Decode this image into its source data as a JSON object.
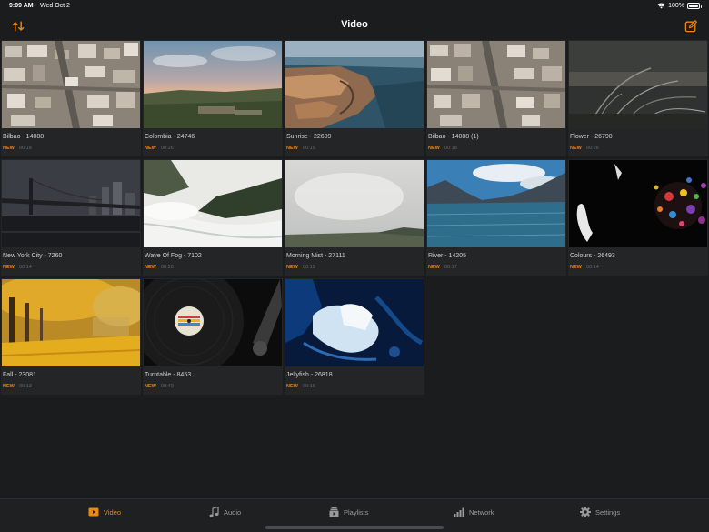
{
  "status": {
    "time": "9:09 AM",
    "date": "Wed Oct 2",
    "battery": "100%",
    "battery_level": 1.0
  },
  "nav": {
    "title": "Video",
    "left_icon": "sort-arrows-icon",
    "right_icon": "edit-icon"
  },
  "colors": {
    "accent": "#f0860c",
    "background": "#1b1c1e",
    "cell": "#242527"
  },
  "videos": [
    {
      "name": "Bilbao - 14088",
      "new": "NEW",
      "duration": "00:18"
    },
    {
      "name": "Colombia - 24746",
      "new": "NEW",
      "duration": "00:26"
    },
    {
      "name": "Sunrise - 22609",
      "new": "NEW",
      "duration": "00:15"
    },
    {
      "name": "Bilbao - 14088 (1)",
      "new": "NEW",
      "duration": "00:18"
    },
    {
      "name": "Flower - 26790",
      "new": "NEW",
      "duration": "00:26"
    },
    {
      "name": "New York City - 7260",
      "new": "NEW",
      "duration": "00:14"
    },
    {
      "name": "Wave Of Fog - 7102",
      "new": "NEW",
      "duration": "00:20"
    },
    {
      "name": "Morning Mist - 27111",
      "new": "NEW",
      "duration": "00:19"
    },
    {
      "name": "River - 14205",
      "new": "NEW",
      "duration": "00:17"
    },
    {
      "name": "Colours - 26493",
      "new": "NEW",
      "duration": "00:14"
    },
    {
      "name": "Fall - 23081",
      "new": "NEW",
      "duration": "00:13"
    },
    {
      "name": "Turntable - 8453",
      "new": "NEW",
      "duration": "00:40"
    },
    {
      "name": "Jellyfish - 26818",
      "new": "NEW",
      "duration": "00:16"
    }
  ],
  "tabs": [
    {
      "label": "Video",
      "icon": "video-icon",
      "active": true
    },
    {
      "label": "Audio",
      "icon": "music-note-icon",
      "active": false
    },
    {
      "label": "Playlists",
      "icon": "playlist-icon",
      "active": false
    },
    {
      "label": "Network",
      "icon": "network-icon",
      "active": false
    },
    {
      "label": "Settings",
      "icon": "gear-icon",
      "active": false
    }
  ]
}
